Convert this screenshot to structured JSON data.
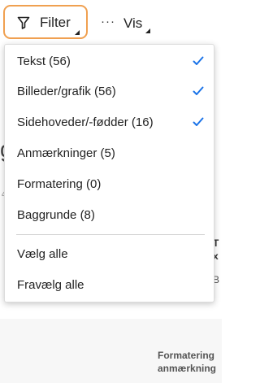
{
  "toolbar": {
    "filter_label": "Filter",
    "view_label": "Vis"
  },
  "filter_menu": {
    "items": [
      {
        "label": "Tekst (56)",
        "checked": true
      },
      {
        "label": "Billeder/grafik (56)",
        "checked": true
      },
      {
        "label": "Sidehoveder/-fødder (16)",
        "checked": true
      },
      {
        "label": "Anmærkninger (5)",
        "checked": false
      },
      {
        "label": "Formatering (0)",
        "checked": false
      },
      {
        "label": "Baggrunde (8)",
        "checked": false
      }
    ],
    "select_all_label": "Vælg alle",
    "deselect_all_label": "Fravælg alle"
  },
  "background": {
    "heading_fragment": "g",
    "small_fragment": "4",
    "side_fragment_1": "T",
    "side_fragment_2": "x",
    "side_fragment_3": "B",
    "footer_line_1": "Formatering",
    "footer_line_2": "anmærkning"
  },
  "colors": {
    "accent_check": "#1a73e8",
    "focus_ring": "#f0a050"
  },
  "icons": {
    "filter": "funnel-icon",
    "view": "more-dots-icon",
    "checked": "checkmark-icon"
  }
}
